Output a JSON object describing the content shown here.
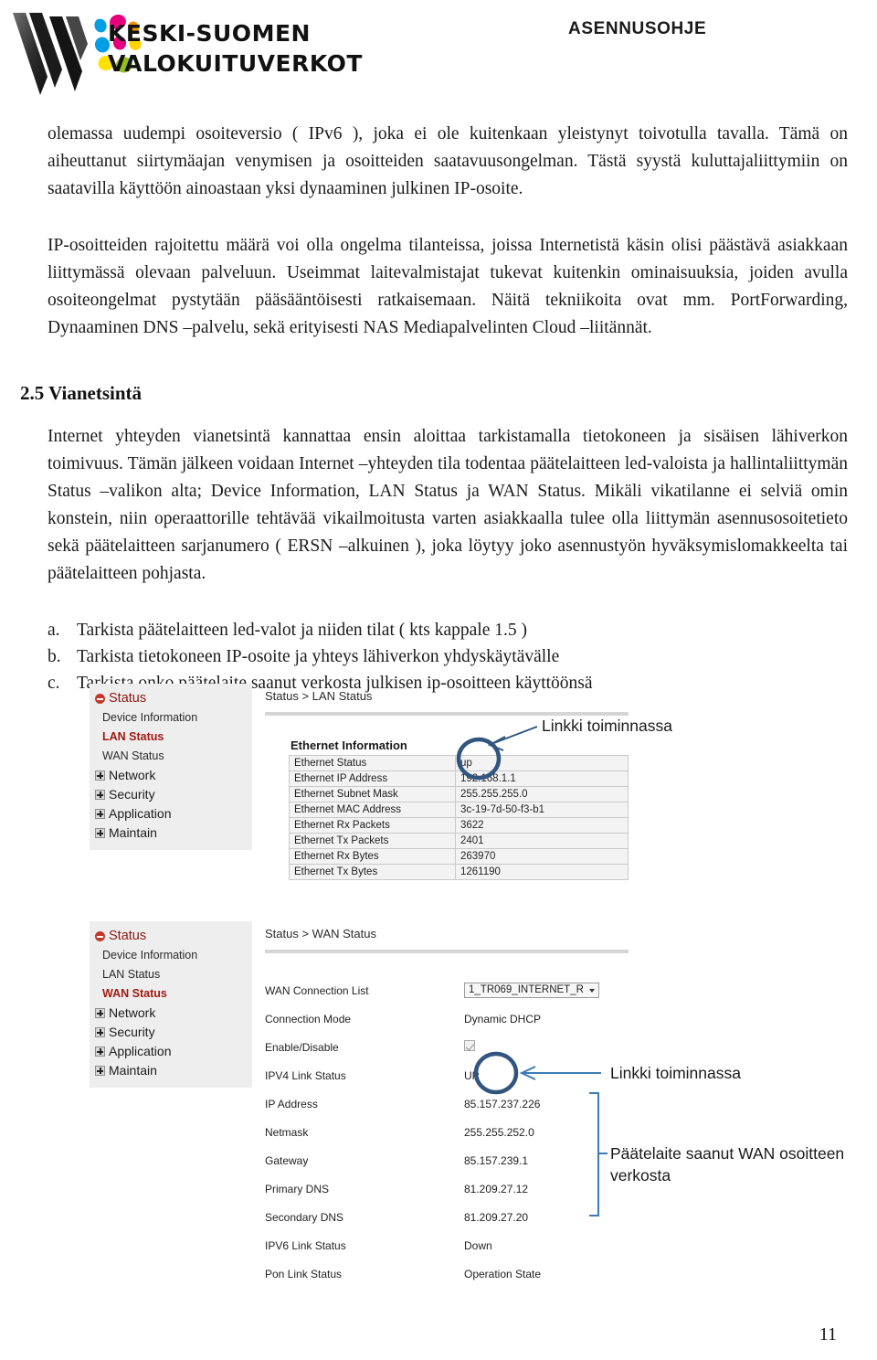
{
  "header": {
    "logo_line1": "KESKI-SUOMEN",
    "logo_line2": "VALOKUITUVERKOT",
    "doc_kind": "ASENNUSOHJE",
    "logo_colors": [
      "#e6007e",
      "#f39200",
      "#ffe000",
      "#95c11f",
      "#009fe3",
      "#1d1d1b"
    ]
  },
  "body": {
    "para1": "olemassa uudempi osoiteversio ( IPv6 ), joka ei ole kuitenkaan yleistynyt toivotulla tavalla. Tämä on aiheuttanut siirtymäajan venymisen ja osoitteiden saatavuusongelman. Tästä syystä kuluttajaliittymiin on saatavilla käyttöön ainoastaan yksi dynaaminen julkinen IP-osoite.",
    "para2": "IP-osoitteiden rajoitettu määrä voi olla ongelma tilanteissa, joissa Internetistä käsin olisi päästävä asiakkaan liittymässä olevaan palveluun. Useimmat laitevalmistajat tukevat kuitenkin ominaisuuksia, joiden avulla osoiteongelmat pystytään pääsääntöisesti ratkaisemaan. Näitä tekniikoita ovat mm. PortForwarding, Dynaaminen DNS –palvelu, sekä erityisesti NAS Mediapalvelinten Cloud –liitännät.",
    "heading": "2.5 Vianetsintä",
    "para3": "Internet yhteyden vianetsintä kannattaa ensin aloittaa tarkistamalla tietokoneen ja sisäisen lähiverkon toimivuus. Tämän jälkeen voidaan Internet –yhteyden tila todentaa päätelaitteen led-valoista ja hallintaliittymän Status –valikon alta; Device Information, LAN Status ja WAN Status. Mikäli vikatilanne ei selviä omin konstein, niin operaattorille tehtävää vikailmoitusta varten asiakkaalla tulee olla liittymän asennusosoitetieto sekä päätelaitteen sarjanumero ( ERSN –alkuinen ), joka löytyy joko asennustyön hyväksymislomakkeelta tai päätelaitteen pohjasta.",
    "checklist": [
      {
        "marker": "a.",
        "text": "Tarkista päätelaitteen led-valot ja niiden tilat ( kts kappale 1.5 )"
      },
      {
        "marker": "b.",
        "text": "Tarkista tietokoneen IP-osoite ja yhteys lähiverkon yhdyskäytävälle"
      },
      {
        "marker": "c.",
        "text": "Tarkista onko päätelaite saanut verkosta julkisen ip-osoitteen käyttöönsä"
      }
    ]
  },
  "lan_shot": {
    "breadcrumb": "Status > LAN Status",
    "nav": [
      {
        "label": "Status",
        "type": "root",
        "icon": "minus-icon"
      },
      {
        "label": "Device Information",
        "type": "sub"
      },
      {
        "label": "LAN Status",
        "type": "active"
      },
      {
        "label": "WAN Status",
        "type": "sub"
      },
      {
        "label": "Network",
        "type": "group",
        "icon": "plus-icon"
      },
      {
        "label": "Security",
        "type": "group",
        "icon": "plus-icon"
      },
      {
        "label": "Application",
        "type": "group",
        "icon": "plus-icon"
      },
      {
        "label": "Maintain",
        "type": "group",
        "icon": "plus-icon"
      }
    ],
    "table_title": "Ethernet Information",
    "rows": [
      {
        "key": "Ethernet Status",
        "value": "up"
      },
      {
        "key": "Ethernet IP Address",
        "value": "192.168.1.1"
      },
      {
        "key": "Ethernet Subnet Mask",
        "value": "255.255.255.0"
      },
      {
        "key": "Ethernet MAC Address",
        "value": "3c-19-7d-50-f3-b1"
      },
      {
        "key": "Ethernet Rx Packets",
        "value": "3622"
      },
      {
        "key": "Ethernet Tx Packets",
        "value": "2401"
      },
      {
        "key": "Ethernet Rx Bytes",
        "value": "263970"
      },
      {
        "key": "Ethernet Tx Bytes",
        "value": "1261190"
      }
    ]
  },
  "wan_shot": {
    "breadcrumb": "Status > WAN Status",
    "nav": [
      {
        "label": "Status",
        "type": "root",
        "icon": "minus-icon"
      },
      {
        "label": "Device Information",
        "type": "sub"
      },
      {
        "label": "LAN Status",
        "type": "sub"
      },
      {
        "label": "WAN Status",
        "type": "active"
      },
      {
        "label": "Network",
        "type": "group",
        "icon": "plus-icon"
      },
      {
        "label": "Security",
        "type": "group",
        "icon": "plus-icon"
      },
      {
        "label": "Application",
        "type": "group",
        "icon": "plus-icon"
      },
      {
        "label": "Maintain",
        "type": "group",
        "icon": "plus-icon"
      }
    ],
    "rows": [
      {
        "key": "WAN Connection List",
        "value": "1_TR069_INTERNET_R",
        "kind": "select"
      },
      {
        "key": "Connection Mode",
        "value": "Dynamic DHCP",
        "kind": "text"
      },
      {
        "key": "Enable/Disable",
        "value": "",
        "kind": "checkbox"
      },
      {
        "key": "IPV4 Link Status",
        "value": "UP",
        "kind": "text"
      },
      {
        "key": "IP Address",
        "value": "85.157.237.226",
        "kind": "text"
      },
      {
        "key": "Netmask",
        "value": "255.255.252.0",
        "kind": "text"
      },
      {
        "key": "Gateway",
        "value": "85.157.239.1",
        "kind": "text"
      },
      {
        "key": "Primary DNS",
        "value": "81.209.27.12",
        "kind": "text"
      },
      {
        "key": "Secondary DNS",
        "value": "81.209.27.20",
        "kind": "text"
      },
      {
        "key": "IPV6 Link Status",
        "value": "Down",
        "kind": "text"
      },
      {
        "key": "Pon Link Status",
        "value": "Operation State",
        "kind": "text"
      }
    ]
  },
  "annotations": {
    "lan_link": "Linkki toiminnassa",
    "wan_link": "Linkki toiminnassa",
    "wan_address_line1": "Päätelaite saanut WAN osoitteen",
    "wan_address_line2": "verkosta",
    "callout_color": "#31557f",
    "bracket_color": "#3d7bb5"
  },
  "footer": {
    "page_number": "11"
  }
}
